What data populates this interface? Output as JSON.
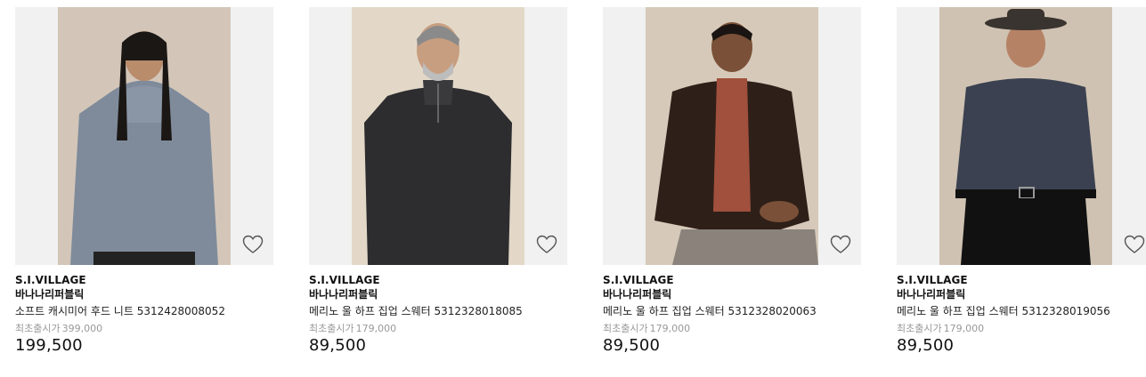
{
  "products": [
    {
      "mall": "S.I.VILLAGE",
      "brand": "바나나리퍼블릭",
      "name": "소프트 캐시미어 후드 니트 5312428008052",
      "orig_label": "최초출시가",
      "orig_price": "399,000",
      "price": "199,500",
      "image_icon": "product-photo",
      "wish_icon": "heart-outline-icon"
    },
    {
      "mall": "S.I.VILLAGE",
      "brand": "바나나리퍼블릭",
      "name": "메리노 울 하프 집업 스웨터 5312328018085",
      "orig_label": "최초출시가",
      "orig_price": "179,000",
      "price": "89,500",
      "image_icon": "product-photo",
      "wish_icon": "heart-outline-icon"
    },
    {
      "mall": "S.I.VILLAGE",
      "brand": "바나나리퍼블릭",
      "name": "메리노 울 하프 집업 스웨터 5312328020063",
      "orig_label": "최초출시가",
      "orig_price": "179,000",
      "price": "89,500",
      "image_icon": "product-photo",
      "wish_icon": "heart-outline-icon"
    },
    {
      "mall": "S.I.VILLAGE",
      "brand": "바나나리퍼블릭",
      "name": "메리노 울 하프 집업 스웨터 5312328019056",
      "orig_label": "최초출시가",
      "orig_price": "179,000",
      "price": "89,500",
      "image_icon": "product-photo",
      "wish_icon": "heart-outline-icon"
    }
  ],
  "colors": {
    "thumb_bg": "#f1f1f1",
    "orig_text": "#999999",
    "text": "#111111"
  }
}
